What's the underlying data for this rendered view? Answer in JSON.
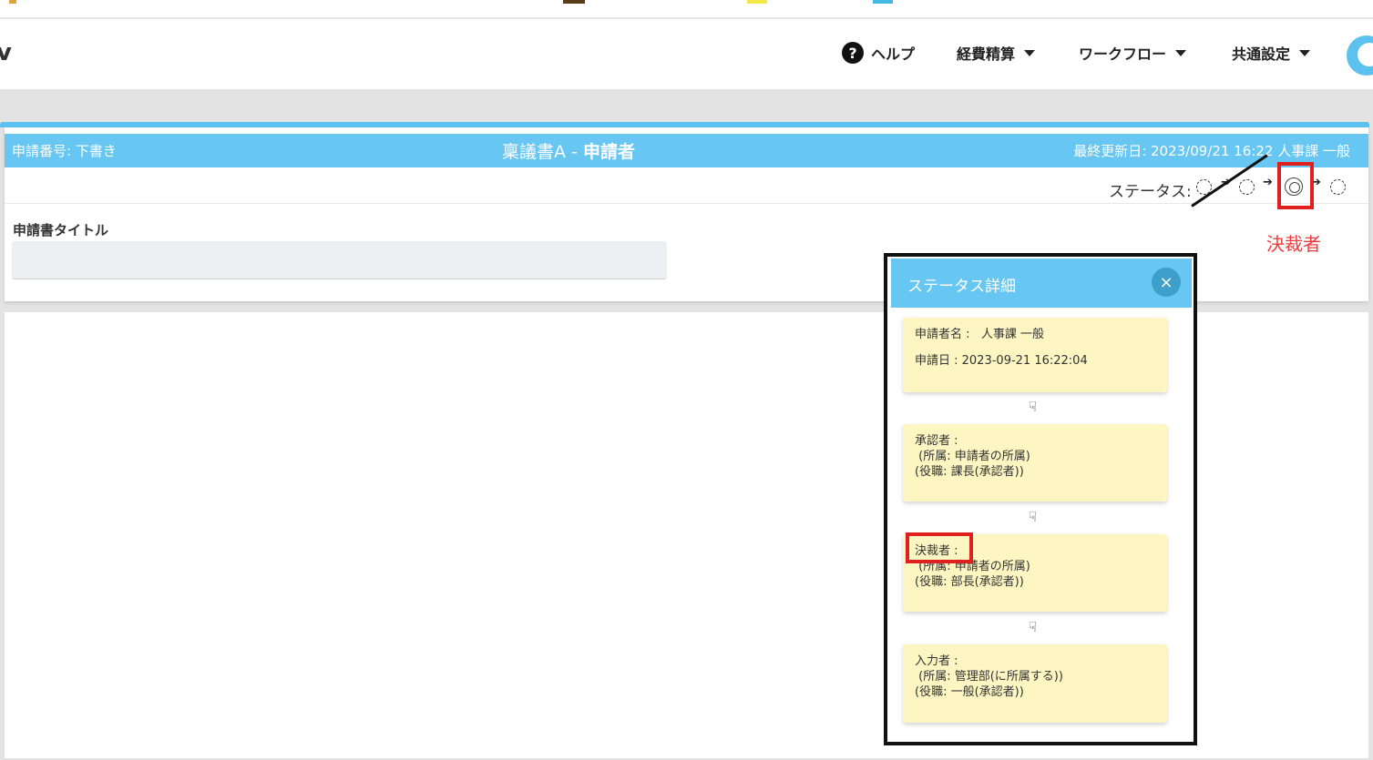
{
  "navbar": {
    "brand": "v",
    "help": "ヘルプ",
    "help_icon": "?",
    "menu": [
      "経費精算",
      "ワークフロー",
      "共通設定"
    ]
  },
  "request": {
    "number_label": "申請番号: 下書き",
    "form_name": "稟議書A - ",
    "role": "申請者",
    "last_updated": "最終更新日: 2023/09/21 16:22  人事課 一般",
    "status_label": "ステータス:",
    "title_label": "申請書タイトル",
    "title_value": ""
  },
  "annotation": {
    "label": "決裁者",
    "color": "#ef3b3b"
  },
  "status_modal": {
    "title": "ステータス詳細",
    "close_icon": "×",
    "arrow_icon": "☟",
    "steps": [
      {
        "lines": [
          "申請者名 :   人事課 一般",
          "",
          "申請日 : 2023-09-21 16:22:04"
        ]
      },
      {
        "lines": [
          "承認者 :",
          " (所属: 申請者の所属)",
          "(役職: 課長(承認者))"
        ]
      },
      {
        "lines": [
          "決裁者 :",
          " (所属: 申請者の所属)",
          "(役職: 部長(承認者))"
        ]
      },
      {
        "lines": [
          "入力者 :",
          " (所属: 管理部(に所属する))",
          "(役職: 一般(承認者))"
        ]
      }
    ]
  },
  "colors": {
    "header_blue": "#67c6f2",
    "card_yellow": "#fdf6c3",
    "highlight_red": "#e0201e"
  }
}
